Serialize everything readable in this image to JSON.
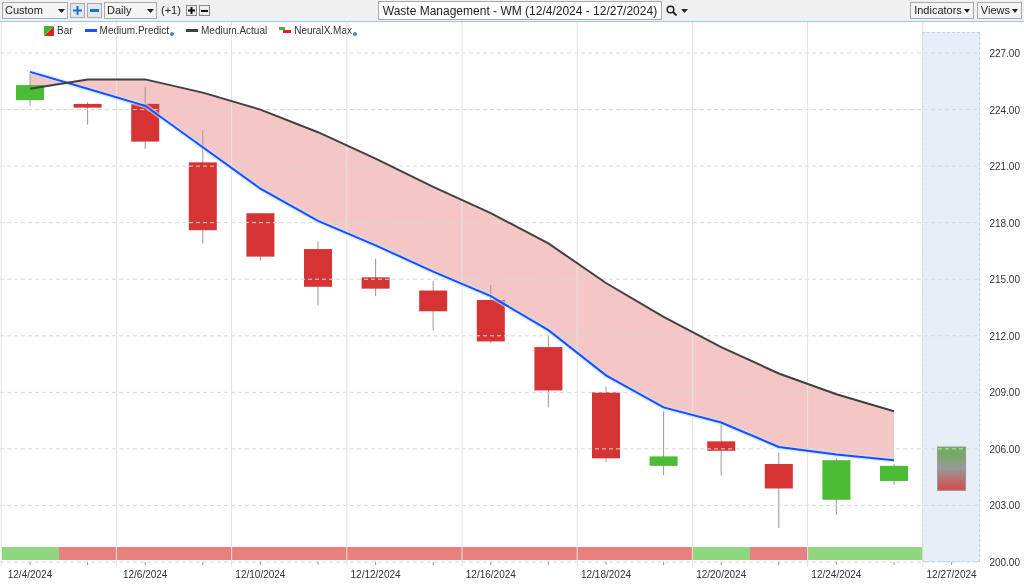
{
  "toolbar": {
    "period_select": "Custom",
    "interval_select": "Daily",
    "offset": "(+1)",
    "title": "Waste Management - WM (12/4/2024 - 12/27/2024)",
    "buttons": [
      "Indicators",
      "Views"
    ]
  },
  "legend": [
    {
      "kind": "bar",
      "label": "Bar",
      "dot": false
    },
    {
      "kind": "predict",
      "dot": true
    },
    {
      "kind": "actual",
      "dot": false
    },
    {
      "kind": "max",
      "label": "NeuralX.Max",
      "dot": true
    }
  ],
  "chart_data": {
    "type": "line",
    "grid": true,
    "categories": [
      "12/4/2024",
      null,
      "12/6/2024",
      null,
      "12/10/2024",
      null,
      "12/12/2024",
      null,
      "12/16/2024",
      null,
      "12/18/2024",
      null,
      "12/20/2024",
      null,
      "12/24/2024",
      null,
      "12/27/2024"
    ],
    "ylim": [
      200,
      227
    ],
    "yticks": [
      {
        "value": 200,
        "label": "200.00"
      },
      {
        "value": 203,
        "label": "203.00"
      },
      {
        "value": 206,
        "label": "206.00"
      },
      {
        "value": 209,
        "label": "209.00"
      },
      {
        "value": 212,
        "label": "212.00"
      },
      {
        "value": 215,
        "label": "215.00"
      },
      {
        "value": 218,
        "label": "218.00"
      },
      {
        "value": 221,
        "label": "221.00"
      },
      {
        "value": 224,
        "label": "224.00"
      },
      {
        "value": 227,
        "label": "227.00"
      }
    ],
    "series": [
      {
        "name": "Medium.Predict",
        "color": "#1f4cff",
        "values": [
          226.0,
          225.1,
          224.2,
          222.0,
          219.8,
          218.1,
          216.8,
          215.4,
          214.1,
          212.3,
          209.9,
          208.2,
          207.4,
          206.1,
          205.7,
          205.4,
          null
        ]
      },
      {
        "name": "Medium.Actual",
        "color": "#404040",
        "values": [
          225.1,
          225.6,
          225.6,
          224.9,
          224.0,
          222.8,
          221.4,
          219.9,
          218.5,
          216.9,
          214.8,
          213.0,
          211.4,
          210.0,
          208.9,
          208.0,
          null
        ]
      }
    ]
  },
  "signal_strip": [
    {
      "color": "#90d67e"
    },
    {
      "color": "#e88080"
    },
    {
      "color": "#e88080"
    },
    {
      "color": "#e88080"
    },
    {
      "color": "#e88080"
    },
    {
      "color": "#e88080"
    },
    {
      "color": "#e88080"
    },
    {
      "color": "#e88080"
    },
    {
      "color": "#e88080"
    },
    {
      "color": "#e88080"
    },
    {
      "color": "#e88080"
    },
    {
      "color": "#e88080"
    },
    {
      "color": "#90d67e"
    },
    {
      "color": "#e88080"
    },
    {
      "color": "#90d67e"
    },
    {
      "color": "#90d67e"
    }
  ]
}
